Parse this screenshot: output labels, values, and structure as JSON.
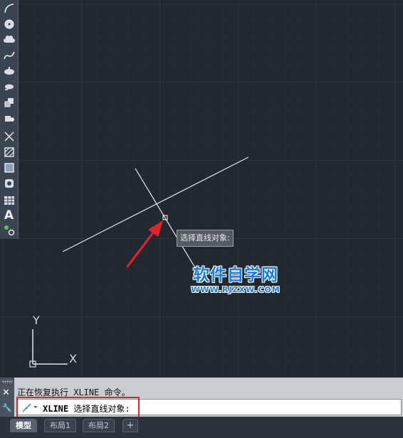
{
  "window": {
    "canvas_background": "#212830",
    "accent_red": "#e5222b"
  },
  "toolbar": {
    "tools": [
      {
        "name": "arc-icon"
      },
      {
        "name": "circle-icon"
      },
      {
        "name": "revision-cloud-icon"
      },
      {
        "name": "spline-icon"
      },
      {
        "name": "ellipse-icon"
      },
      {
        "name": "ellipse-arc-icon"
      },
      {
        "name": "insert-block-icon"
      },
      {
        "name": "make-block-icon"
      },
      {
        "name": "point-icon"
      },
      {
        "name": "hatch-icon"
      },
      {
        "name": "gradient-icon"
      },
      {
        "name": "region-icon"
      },
      {
        "name": "table-icon"
      },
      {
        "name": "multiline-text-icon",
        "label": "A"
      },
      {
        "name": "add-selected-icon"
      }
    ]
  },
  "drawing": {
    "tooltip": "选择直线对象:",
    "watermark": {
      "title": "软件自学网",
      "url": "WWW.RJZXW.COM"
    },
    "ucs": {
      "x_label": "X",
      "y_label": "Y"
    }
  },
  "command": {
    "history_line": "正在恢复执行 XLINE 命令。",
    "prompt_keyword": "XLINE",
    "prompt_text": " 选择直线对象:"
  },
  "tabs": {
    "items": [
      {
        "label": "模型",
        "active": true
      },
      {
        "label": "布局1",
        "active": false
      },
      {
        "label": "布局2",
        "active": false
      }
    ],
    "add_label": "+"
  }
}
